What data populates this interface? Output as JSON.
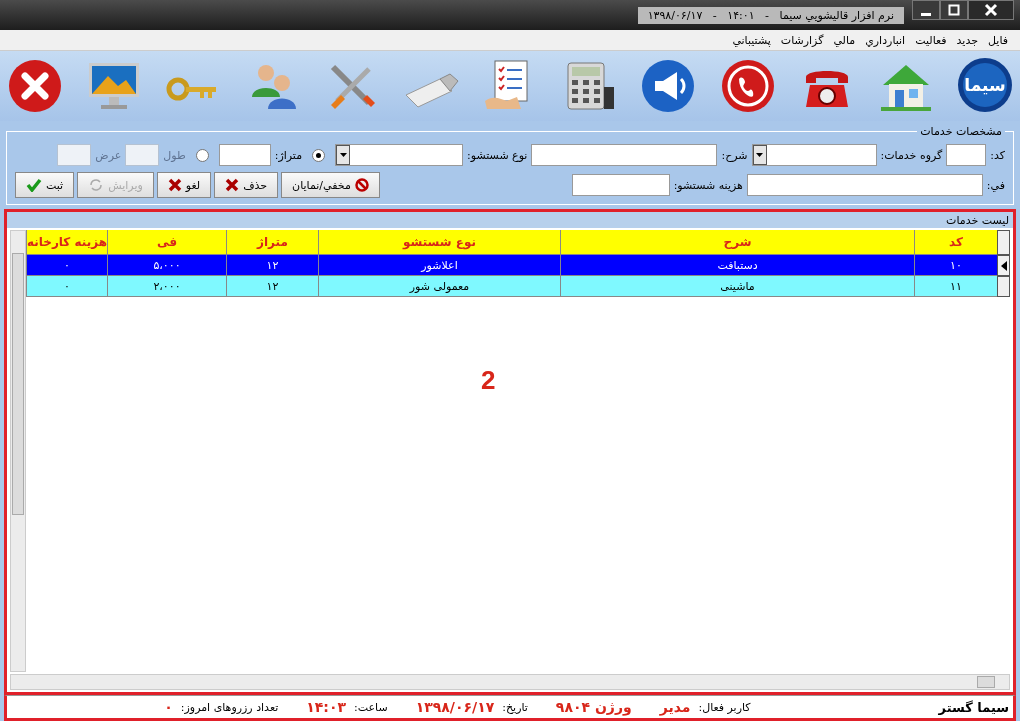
{
  "window": {
    "title": "نرم افزار قاليشويي سيما   -   ۱۴:۰۱   -   ۱۳۹۸/۰۶/۱۷"
  },
  "menu": [
    "فایل",
    "جدید",
    "فعالیت",
    "انبارداري",
    "مالي",
    "گزارشات",
    "پشتيباني"
  ],
  "toolbar": {
    "logo_text": "سیما"
  },
  "form": {
    "title": "مشخصات خدمات",
    "row1": [
      {
        "kind": "field",
        "label": "کد:",
        "combo": false,
        "disabled": false
      },
      {
        "kind": "field",
        "label": "گروه خدمات:",
        "combo": true,
        "disabled": false
      },
      {
        "kind": "field",
        "label": "شرح:",
        "combo": false,
        "disabled": false
      },
      {
        "kind": "field",
        "label": "نوع شستشو:",
        "combo": true,
        "disabled": false
      },
      {
        "kind": "radio",
        "selected": true
      },
      {
        "kind": "field",
        "label": "متراژ:",
        "combo": false,
        "disabled": false
      },
      {
        "kind": "radio",
        "selected": false
      },
      {
        "kind": "field",
        "label": "طول",
        "combo": false,
        "disabled": true
      },
      {
        "kind": "field",
        "label": "عرض",
        "combo": false,
        "disabled": true
      }
    ],
    "row2": [
      {
        "label": "في:"
      },
      {
        "label": "هزینه شستشو:"
      }
    ],
    "buttons": [
      {
        "label": "مخفي/نمایان",
        "kind": "ban",
        "disabled": false
      },
      {
        "label": "حذف",
        "kind": "cross",
        "disabled": false
      },
      {
        "label": "لغو",
        "kind": "cross",
        "disabled": false
      },
      {
        "label": "ویرایش",
        "kind": "refresh",
        "disabled": true
      },
      {
        "label": "ثبت",
        "kind": "check",
        "disabled": false
      }
    ]
  },
  "list": {
    "title": "لیست خدمات",
    "columns": [
      "کد",
      "شرح",
      "نوع شستشو",
      "متراژ",
      "فی",
      "هزینه کارخانه"
    ],
    "rows": [
      {
        "selected": true,
        "cells": [
          "۱۰",
          "دستبافت",
          "اعلاشور",
          "۱۲",
          "۵،۰۰۰",
          "۰"
        ]
      },
      {
        "selected": false,
        "cells": [
          "۱۱",
          "ماشینی",
          "معمولی شور",
          "۱۲",
          "۲،۰۰۰",
          "۰"
        ]
      }
    ],
    "annotation": "2"
  },
  "status_bar": [
    {
      "kind": "brand",
      "text": "سیما گستر"
    },
    {
      "kind": "label",
      "text": "کاربر فعال:"
    },
    {
      "kind": "value",
      "text": "مدیر"
    },
    {
      "kind": "value",
      "text": "ورژن ۹۸۰۴"
    },
    {
      "kind": "label",
      "text": "تاریخ:"
    },
    {
      "kind": "value",
      "text": "۱۳۹۸/۰۶/۱۷"
    },
    {
      "kind": "label",
      "text": "ساعت:"
    },
    {
      "kind": "value",
      "text": "۱۴:۰۳"
    },
    {
      "kind": "label",
      "text": "تعداد رزروهای امروز:"
    },
    {
      "kind": "value",
      "text": "۰"
    }
  ]
}
